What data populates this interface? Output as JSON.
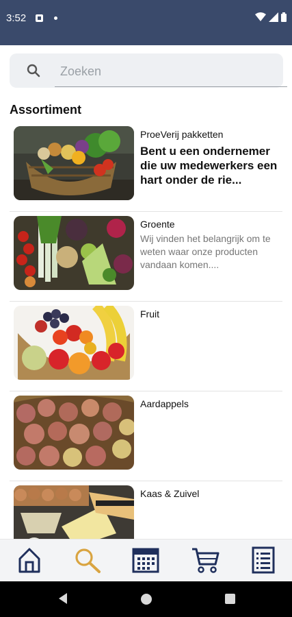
{
  "status": {
    "time": "3:52"
  },
  "search": {
    "placeholder": "Zoeken"
  },
  "section_title": "Assortiment",
  "items": [
    {
      "name": "ProeVerij pakketten",
      "headline": "Bent u een ondernemer die uw medewerkers een hart onder de rie...",
      "desc": ""
    },
    {
      "name": "Groente",
      "headline": "",
      "desc": "Wij vinden het belangrijk om te weten waar onze producten vandaan komen...."
    },
    {
      "name": "Fruit",
      "headline": "",
      "desc": ""
    },
    {
      "name": "Aardappels",
      "headline": "",
      "desc": ""
    },
    {
      "name": "Kaas & Zuivel",
      "headline": "",
      "desc": ""
    }
  ],
  "nav": [
    {
      "icon": "home-icon"
    },
    {
      "icon": "search-icon"
    },
    {
      "icon": "calendar-icon"
    },
    {
      "icon": "cart-icon"
    },
    {
      "icon": "list-icon"
    }
  ],
  "colors": {
    "status_bar": "#3a4a6b",
    "nav_blue": "#1f2f5c",
    "search_gold": "#d9a441"
  }
}
